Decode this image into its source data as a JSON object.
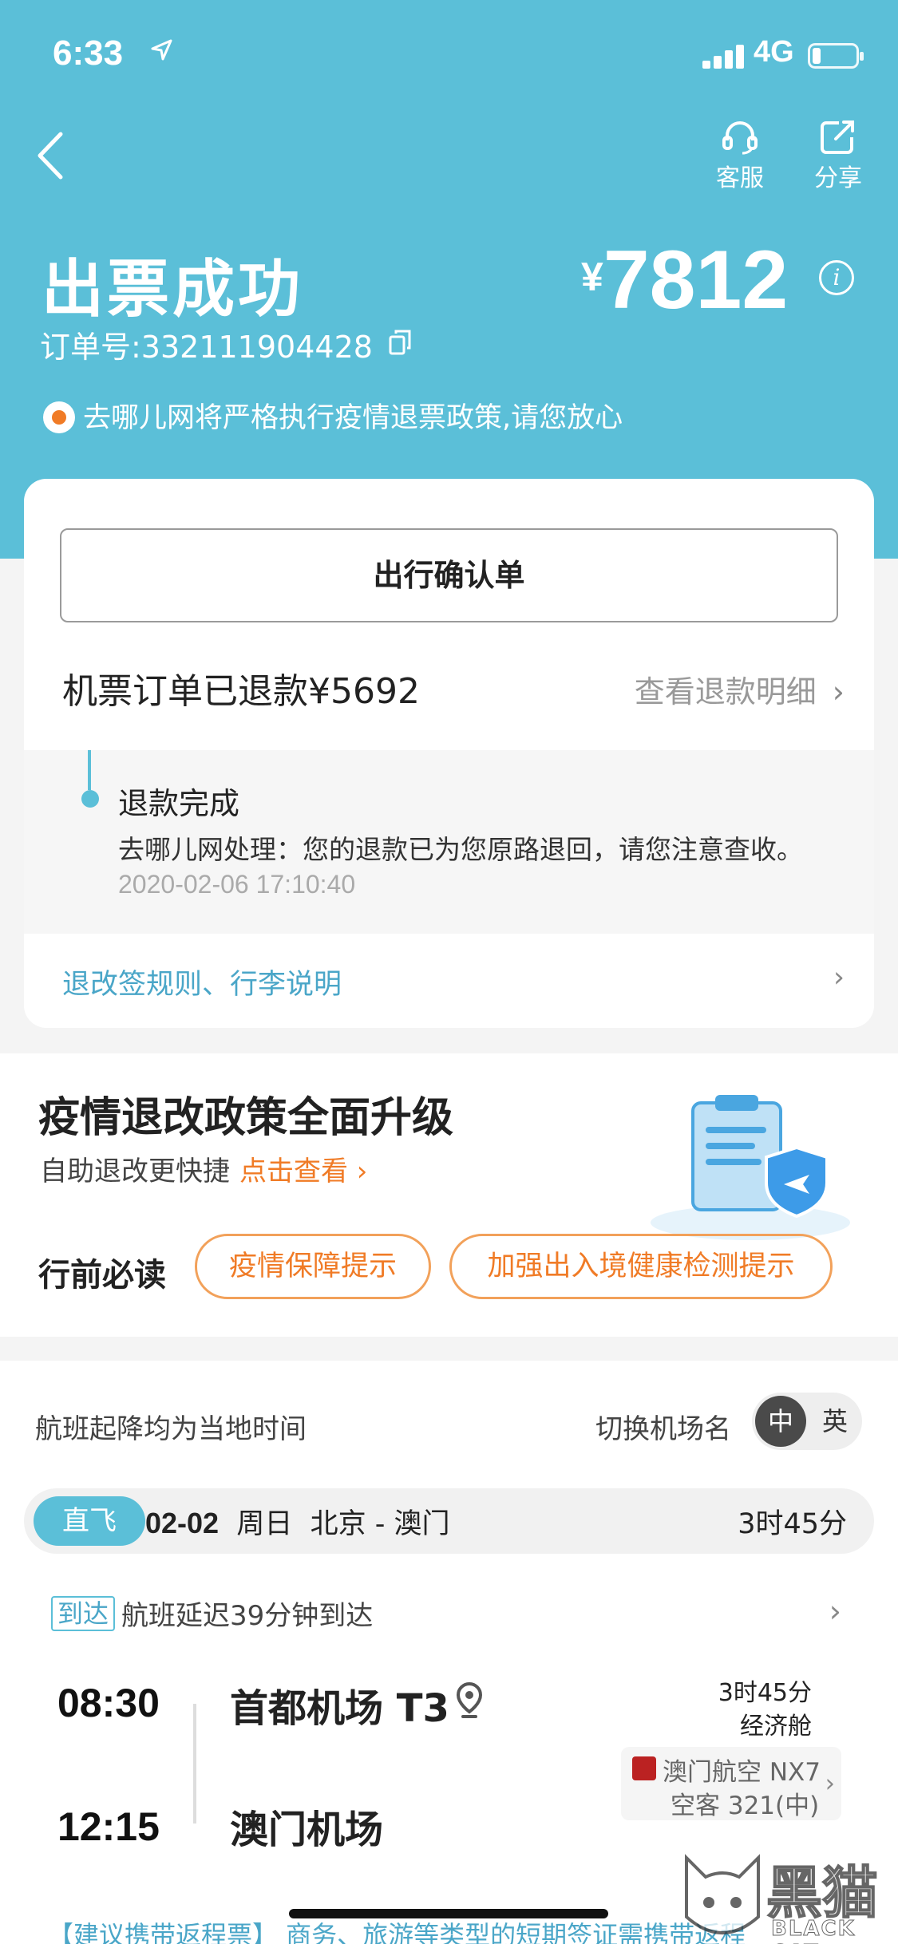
{
  "status_bar": {
    "time": "6:33",
    "network": "4G"
  },
  "header": {
    "service_label": "客服",
    "share_label": "分享",
    "title": "出票成功",
    "currency": "¥",
    "price": "7812",
    "order_number": "订单号:332111904428",
    "notice": "去哪儿网将严格执行疫情退票政策,请您放心"
  },
  "refund_card": {
    "confirm_button": "出行确认单",
    "refund_status": "机票订单已退款¥5692",
    "refund_detail_link": "查看退款明细",
    "timeline": {
      "title": "退款完成",
      "message": "去哪儿网处理：您的退款已为您原路退回，请您注意查收。",
      "timestamp": "2020-02-06 17:10:40"
    },
    "rules_link": "退改签规则、行李说明"
  },
  "policy": {
    "heading": "疫情退改政策全面升级",
    "subtitle": "自助退改更快捷",
    "subtitle_link": "点击查看 ›",
    "must_read": "行前必读",
    "pills": [
      "疫情保障提示",
      "加强出入境健康检测提示"
    ]
  },
  "flight": {
    "local_time_note": "航班起降均为当地时间",
    "switch_label": "切换机场名",
    "toggle_on": "中",
    "toggle_off": "英",
    "tag": "直飞",
    "date": "02-02",
    "weekday": "周日",
    "route": "北京 - 澳门",
    "duration": "3时45分",
    "arrive_tag": "到达",
    "arrive_text": "航班延迟39分钟到达",
    "dep_time": "08:30",
    "dep_airport": "首都机场 T3",
    "arr_time": "12:15",
    "arr_airport": "澳门机场",
    "info_duration": "3时45分",
    "cabin": "经济舱",
    "airline": "澳门航空 NX7",
    "aircraft": "空客 321(中)"
  },
  "bottom_text": "【建议携带返程票】 商务、旅游等类型的短期签证需携带返程",
  "watermark": {
    "cn": "黑猫",
    "en": "BLACK CAT"
  },
  "colors": {
    "header_bg": "#5bbfd8",
    "accent_orange": "#f07b26",
    "link_blue": "#4aa6c8"
  }
}
